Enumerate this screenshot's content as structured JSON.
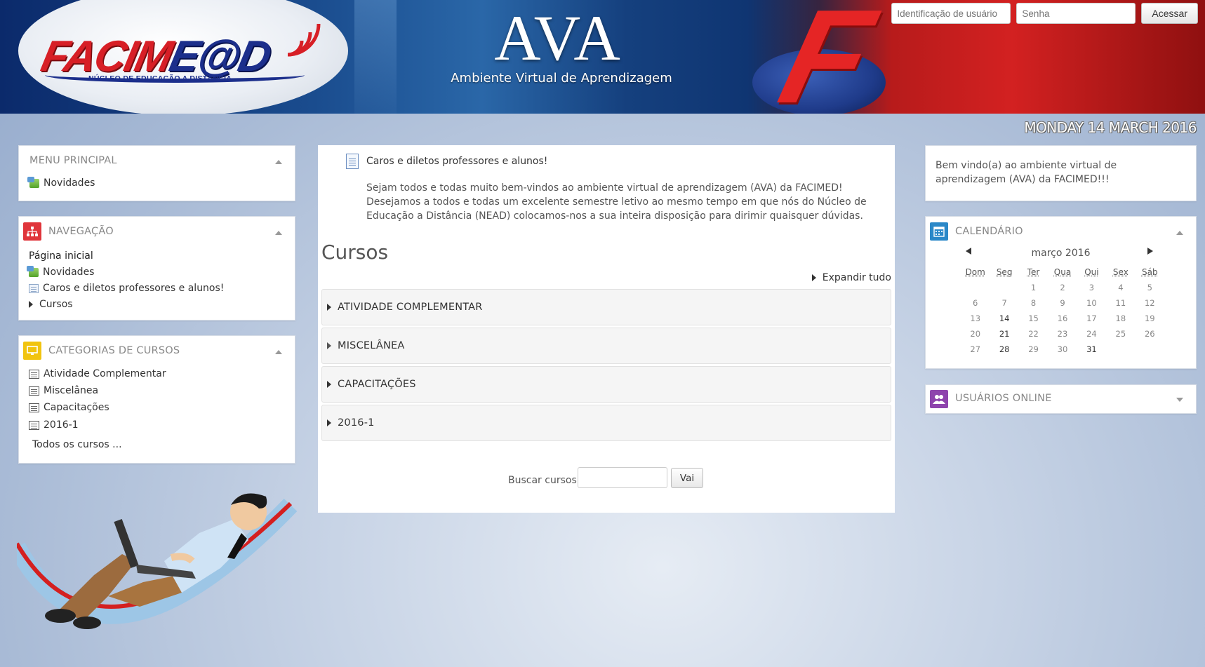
{
  "header": {
    "logo_main_red": "FACIM",
    "logo_main_blue": "E@D",
    "logo_subtitle": "NÚCLEO DE EDUCAÇÃO A DISTÂNCIA",
    "ava_title": "AVA",
    "ava_subtitle": "Ambiente Virtual de Aprendizagem",
    "login": {
      "username_placeholder": "Identificação de usuário",
      "password_placeholder": "Senha",
      "submit_label": "Acessar"
    },
    "date": "MONDAY 14 MARCH 2016"
  },
  "menu_principal": {
    "title": "MENU PRINCIPAL",
    "items": [
      {
        "label": "Novidades",
        "icon": "news-icon"
      }
    ]
  },
  "navegacao": {
    "title": "NAVEGAÇÃO",
    "home": "Página inicial",
    "items": [
      {
        "label": "Novidades",
        "icon": "news-icon"
      },
      {
        "label": "Caros e diletos professores e alunos!",
        "icon": "page-icon"
      },
      {
        "label": "Cursos",
        "icon": "expand-arrow"
      }
    ]
  },
  "categorias": {
    "title": "CATEGORIAS DE CURSOS",
    "items": [
      {
        "label": "Atividade Complementar"
      },
      {
        "label": "Miscelânea"
      },
      {
        "label": "Capacitações"
      },
      {
        "label": "2016-1"
      }
    ],
    "all_courses": "Todos os cursos ..."
  },
  "main": {
    "post_title": "Caros e diletos professores e alunos!",
    "post_body": "Sejam todos e todas muito bem-vindos ao ambiente virtual de aprendizagem (AVA) da FACIMED! Desejamos a todos e todas um excelente semestre letivo ao mesmo tempo em que nós do Núcleo de Educação a Distância (NEAD) colocamos-nos a sua inteira disposição para dirimir quaisquer dúvidas.",
    "courses_title": "Cursos",
    "expand_all": "Expandir tudo",
    "courses": [
      {
        "label": "ATIVIDADE COMPLEMENTAR"
      },
      {
        "label": "MISCELÂNEA"
      },
      {
        "label": "CAPACITAÇÕES"
      },
      {
        "label": "2016-1"
      }
    ],
    "search_label": "Buscar cursos:",
    "search_button": "Vai"
  },
  "welcome": {
    "text": "Bem vindo(a) ao ambiente virtual de aprendizagem (AVA) da FACIMED!!!"
  },
  "calendario": {
    "title": "CALENDÁRIO",
    "month": "março 2016",
    "weekdays": [
      "Dom",
      "Seg",
      "Ter",
      "Qua",
      "Qui",
      "Sex",
      "Sáb"
    ],
    "weeks": [
      [
        "",
        "",
        "1",
        "2",
        "3",
        "4",
        "5"
      ],
      [
        "6",
        "7",
        "8",
        "9",
        "10",
        "11",
        "12"
      ],
      [
        "13",
        "14",
        "15",
        "16",
        "17",
        "18",
        "19"
      ],
      [
        "20",
        "21",
        "22",
        "23",
        "24",
        "25",
        "26"
      ],
      [
        "27",
        "28",
        "29",
        "30",
        "31",
        "",
        ""
      ]
    ]
  },
  "usuarios_online": {
    "title": "USUÁRIOS ONLINE"
  },
  "colors": {
    "nav_icon": "#e0353b",
    "categories_icon": "#f1c40f",
    "calendar_icon": "#2b88c8",
    "users_icon": "#8e44ad",
    "logo_red": "#d71f26",
    "logo_blue": "#1c2f8c"
  }
}
